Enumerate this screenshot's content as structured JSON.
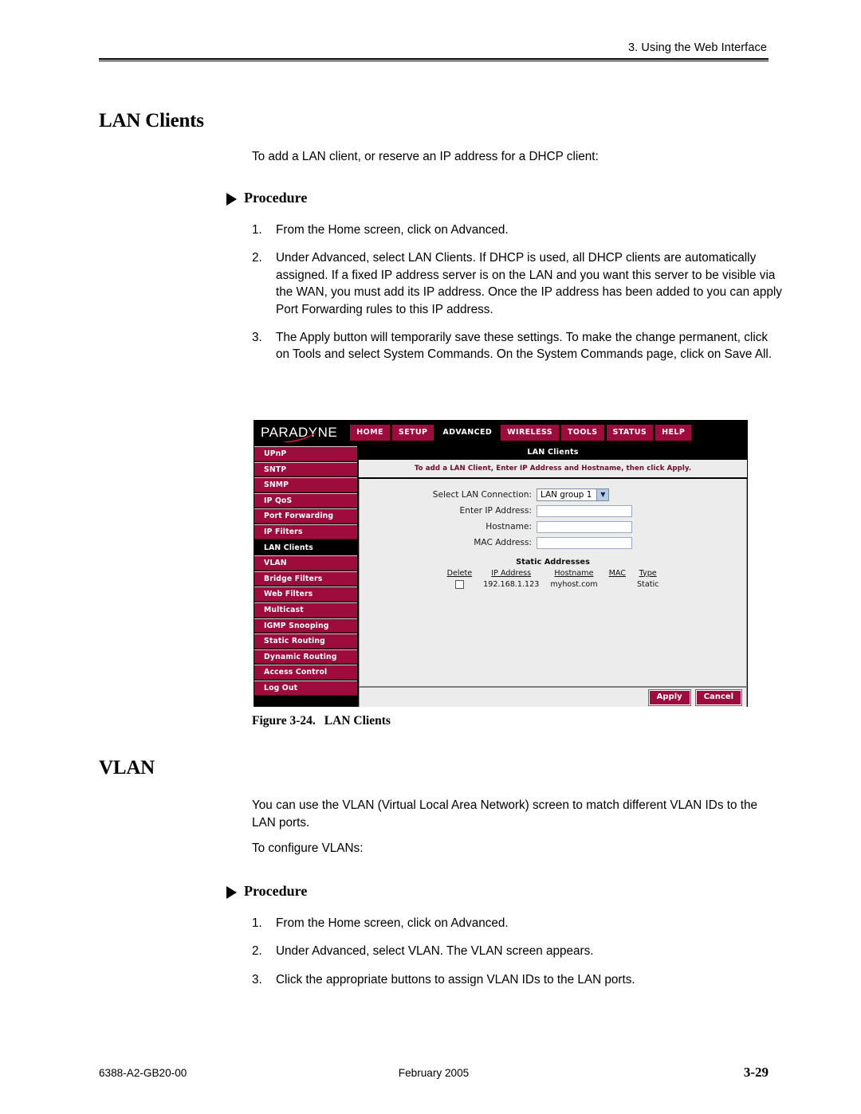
{
  "header": {
    "running_head": "3. Using the Web Interface"
  },
  "sections": [
    {
      "heading": "LAN Clients",
      "intro": "To add a LAN client, or reserve an IP address for a DHCP client:",
      "procedure_label": "Procedure",
      "steps": [
        {
          "num": "1.",
          "text": "From the Home screen, click on Advanced."
        },
        {
          "num": "2.",
          "text": "Under Advanced, select LAN Clients. If DHCP is used, all DHCP clients are automatically assigned. If a fixed IP address server is on the LAN and you want this server to be visible via the WAN, you must add its IP address. Once the IP address has been added to you can apply Port Forwarding rules to this IP address."
        },
        {
          "num": "3.",
          "text": "The Apply button will temporarily save these settings. To make the change permanent, click on Tools and select System Commands. On the System Commands page, click on Save All."
        }
      ]
    },
    {
      "heading": "VLAN",
      "intro": "You can use the VLAN (Virtual Local Area Network) screen to match different VLAN IDs to the LAN ports.",
      "intro2": "To configure VLANs:",
      "procedure_label": "Procedure",
      "steps": [
        {
          "num": "1.",
          "text": "From the Home screen, click on Advanced."
        },
        {
          "num": "2.",
          "text": "Under Advanced, select VLAN. The VLAN screen appears."
        },
        {
          "num": "3.",
          "text": "Click the appropriate buttons to assign VLAN IDs to the LAN ports."
        }
      ]
    }
  ],
  "figure": {
    "caption_label": "Figure 3-24.",
    "caption_text": "LAN Clients",
    "colors": {
      "brand_maroon": "#9e0b3d",
      "selected_black": "#000000",
      "panel_gray": "#ececec",
      "instruction_text": "#6e0b2c"
    },
    "screenshot": {
      "logo": "PARADYNE",
      "nav_tabs": [
        {
          "label": "HOME",
          "selected": false
        },
        {
          "label": "SETUP",
          "selected": false
        },
        {
          "label": "ADVANCED",
          "selected": true
        },
        {
          "label": "WIRELESS",
          "selected": false
        },
        {
          "label": "TOOLS",
          "selected": false
        },
        {
          "label": "STATUS",
          "selected": false
        },
        {
          "label": "HELP",
          "selected": false
        }
      ],
      "sidebar_items": [
        {
          "label": "UPnP",
          "selected": false
        },
        {
          "label": "SNTP",
          "selected": false
        },
        {
          "label": "SNMP",
          "selected": false
        },
        {
          "label": "IP QoS",
          "selected": false
        },
        {
          "label": "Port Forwarding",
          "selected": false
        },
        {
          "label": "IP Filters",
          "selected": false
        },
        {
          "label": "LAN Clients",
          "selected": true
        },
        {
          "label": "VLAN",
          "selected": false
        },
        {
          "label": "Bridge Filters",
          "selected": false
        },
        {
          "label": "Web Filters",
          "selected": false
        },
        {
          "label": "Multicast",
          "selected": false
        },
        {
          "label": "IGMP Snooping",
          "selected": false
        },
        {
          "label": "Static Routing",
          "selected": false
        },
        {
          "label": "Dynamic Routing",
          "selected": false
        },
        {
          "label": "Access Control",
          "selected": false
        },
        {
          "label": "Log Out",
          "selected": false
        }
      ],
      "panel_title": "LAN Clients",
      "instruction": "To add a LAN Client, Enter IP Address and Hostname, then click Apply.",
      "form": {
        "lan_connection_label": "Select LAN Connection:",
        "lan_connection_value": "LAN group 1",
        "ip_address_label": "Enter IP Address:",
        "ip_address_value": "",
        "hostname_label": "Hostname:",
        "hostname_value": "",
        "mac_address_label": "MAC Address:",
        "mac_address_value": ""
      },
      "static_addresses": {
        "title": "Static Addresses",
        "columns": [
          "Delete",
          "IP Address",
          "Hostname",
          "MAC",
          "Type"
        ],
        "rows": [
          {
            "delete": "",
            "ip_address": "192.168.1.123",
            "hostname": "myhost.com",
            "mac": "",
            "type": "Static"
          }
        ]
      },
      "buttons": {
        "apply": "Apply",
        "cancel": "Cancel"
      }
    }
  },
  "footer": {
    "document_number": "6388-A2-GB20-00",
    "date": "February 2005",
    "page_number": "3-29"
  }
}
